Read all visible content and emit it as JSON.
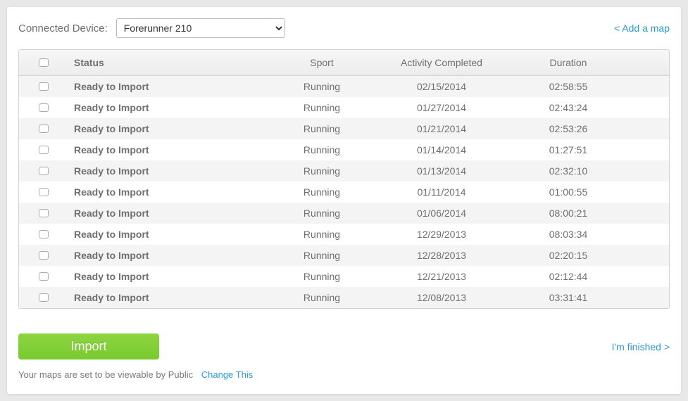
{
  "header": {
    "device_label": "Connected Device:",
    "device_selected": "Forerunner 210",
    "add_map_label": "< Add a map"
  },
  "table": {
    "columns": {
      "status": "Status",
      "sport": "Sport",
      "date": "Activity Completed",
      "duration": "Duration"
    },
    "rows": [
      {
        "status": "Ready to Import",
        "sport": "Running",
        "date": "02/15/2014",
        "duration": "02:58:55"
      },
      {
        "status": "Ready to Import",
        "sport": "Running",
        "date": "01/27/2014",
        "duration": "02:43:24"
      },
      {
        "status": "Ready to Import",
        "sport": "Running",
        "date": "01/21/2014",
        "duration": "02:53:26"
      },
      {
        "status": "Ready to Import",
        "sport": "Running",
        "date": "01/14/2014",
        "duration": "01:27:51"
      },
      {
        "status": "Ready to Import",
        "sport": "Running",
        "date": "01/13/2014",
        "duration": "02:32:10"
      },
      {
        "status": "Ready to Import",
        "sport": "Running",
        "date": "01/11/2014",
        "duration": "01:00:55"
      },
      {
        "status": "Ready to Import",
        "sport": "Running",
        "date": "01/06/2014",
        "duration": "08:00:21"
      },
      {
        "status": "Ready to Import",
        "sport": "Running",
        "date": "12/29/2013",
        "duration": "08:03:34"
      },
      {
        "status": "Ready to Import",
        "sport": "Running",
        "date": "12/28/2013",
        "duration": "02:20:15"
      },
      {
        "status": "Ready to Import",
        "sport": "Running",
        "date": "12/21/2013",
        "duration": "02:12:44"
      },
      {
        "status": "Ready to Import",
        "sport": "Running",
        "date": "12/08/2013",
        "duration": "03:31:41"
      }
    ]
  },
  "footer": {
    "import_label": "Import",
    "finished_label": "I'm finished >",
    "privacy_note": "Your maps are set to be viewable by Public",
    "change_label": "Change This"
  }
}
